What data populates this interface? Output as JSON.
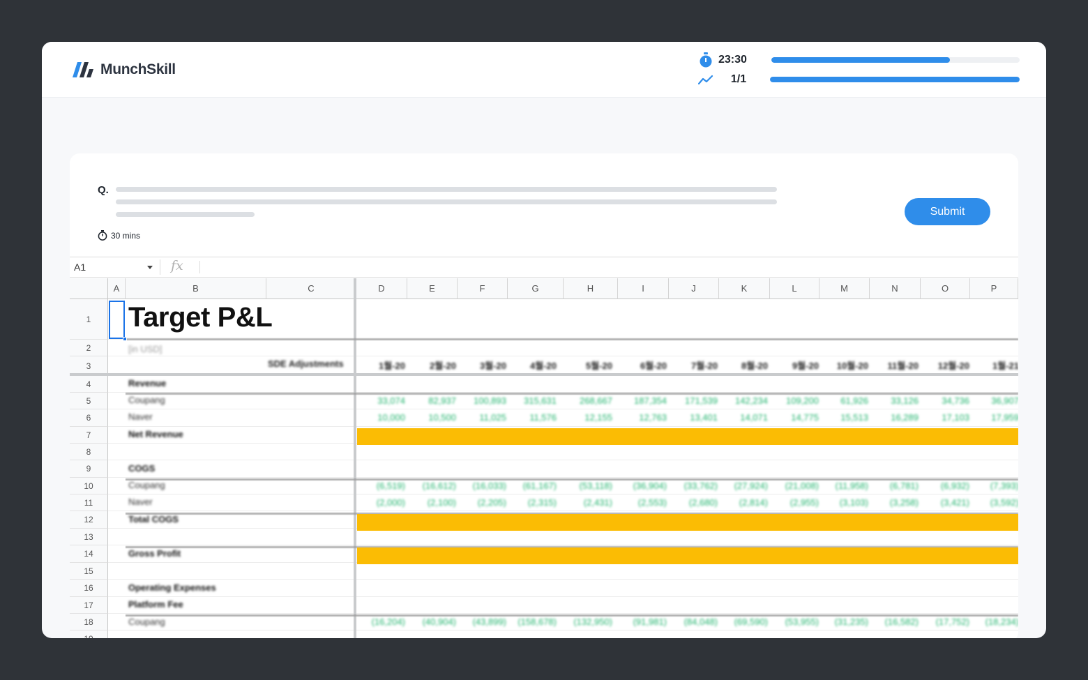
{
  "brand": {
    "name": "MunchSkill",
    "accent": "#2f8dea"
  },
  "timer": {
    "icon": "stopwatch-icon",
    "value": "23:30",
    "progress_fraction": 0.72
  },
  "progress": {
    "icon": "trend-line-icon",
    "value": "1/1",
    "progress_fraction": 1.0
  },
  "question": {
    "label": "Q.",
    "duration": "30 mins",
    "duration_icon": "stopwatch-icon",
    "submit_label": "Submit"
  },
  "sheet": {
    "name_box": "A1",
    "fx_label": "fx",
    "columns": [
      "A",
      "B",
      "C",
      "D",
      "E",
      "F",
      "G",
      "H",
      "I",
      "J",
      "K",
      "L",
      "M",
      "N",
      "O",
      "P"
    ],
    "rows": [
      "1",
      "2",
      "3",
      "4",
      "5",
      "6",
      "7",
      "8",
      "9",
      "10",
      "11",
      "12",
      "13",
      "14",
      "15",
      "16",
      "17",
      "18",
      "19"
    ],
    "title": "Target P&L",
    "subtitle": "[in USD]",
    "sde_label": "SDE Adjustments",
    "dates": [
      "1월-20",
      "2월-20",
      "3월-20",
      "4월-20",
      "5월-20",
      "6월-20",
      "7월-20",
      "8월-20",
      "9월-20",
      "10월-20",
      "11월-20",
      "12월-20",
      "1월-21"
    ],
    "labels": {
      "revenue": "Revenue",
      "coupang": "Coupang",
      "naver": "Naver",
      "net_revenue": "Net Revenue",
      "cogs": "COGS",
      "total_cogs": "Total COGS",
      "gross_profit": "Gross Profit",
      "opex": "Operating Expenses",
      "platform_fee": "Platform Fee"
    },
    "revenue_coupang": [
      "33,074",
      "82,937",
      "100,893",
      "315,631",
      "268,667",
      "187,354",
      "171,539",
      "142,234",
      "109,200",
      "61,926",
      "33,126",
      "34,736",
      "36,907"
    ],
    "revenue_naver": [
      "10,000",
      "10,500",
      "11,025",
      "11,576",
      "12,155",
      "12,763",
      "13,401",
      "14,071",
      "14,775",
      "15,513",
      "16,289",
      "17,103",
      "17,959"
    ],
    "cogs_coupang": [
      "(6,519)",
      "(16,612)",
      "(16,033)",
      "(61,167)",
      "(53,118)",
      "(36,904)",
      "(33,762)",
      "(27,924)",
      "(21,008)",
      "(11,958)",
      "(6,781)",
      "(6,932)",
      "(7,393)"
    ],
    "cogs_naver": [
      "(2,000)",
      "(2,100)",
      "(2,205)",
      "(2,315)",
      "(2,431)",
      "(2,553)",
      "(2,680)",
      "(2,814)",
      "(2,955)",
      "(3,103)",
      "(3,258)",
      "(3,421)",
      "(3,592)"
    ],
    "fee_coupang": [
      "(16,204)",
      "(40,904)",
      "(43,899)",
      "(158,678)",
      "(132,950)",
      "(91,981)",
      "(84,048)",
      "(69,590)",
      "(53,955)",
      "(31,235)",
      "(16,582)",
      "(17,752)",
      "(18,234)"
    ],
    "highlight_color": "#fbbc04",
    "number_color": "#1fb36c"
  }
}
